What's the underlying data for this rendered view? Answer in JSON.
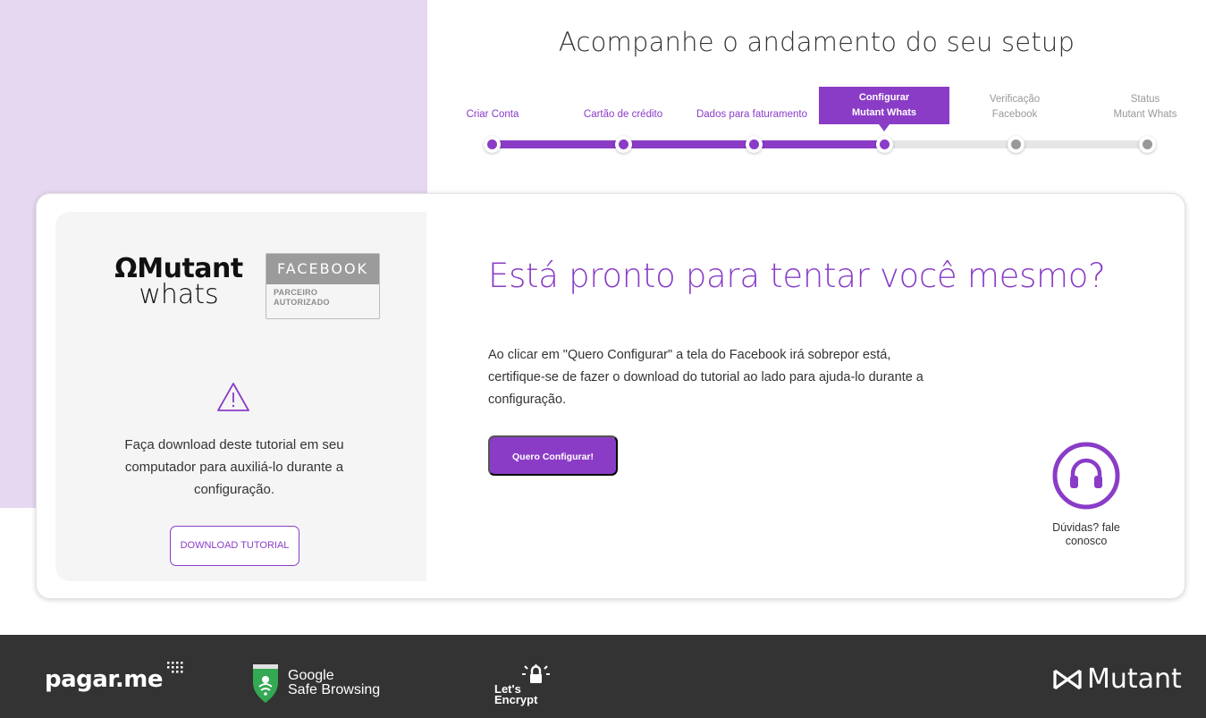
{
  "header": {
    "title": "Acompanhe o andamento do seu setup"
  },
  "steps": [
    {
      "line1": "",
      "line2": "Criar Conta",
      "state": "done"
    },
    {
      "line1": "",
      "line2": "Cartão de crédito",
      "state": "done"
    },
    {
      "line1": "",
      "line2": "Dados para faturamento",
      "state": "done"
    },
    {
      "line1": "Configurar",
      "line2": "Mutant Whats",
      "state": "active"
    },
    {
      "line1": "Verificação",
      "line2": "Facebook",
      "state": "pending"
    },
    {
      "line1": "Status",
      "line2": "Mutant Whats",
      "state": "pending"
    }
  ],
  "left_panel": {
    "logo_line1": "Mutant",
    "logo_line2": "whats",
    "badge_top": "FACEBOOK",
    "badge_bottom_1": "PARCEIRO",
    "badge_bottom_2": "AUTORIZADO",
    "warning_icon": "warning-triangle-icon",
    "download_text": "Faça download deste tutorial em seu computador para auxiliá-lo durante a configuração.",
    "download_button": "DOWNLOAD TUTORIAL"
  },
  "main": {
    "title": "Está pronto para tentar você mesmo?",
    "text": "Ao clicar em \"Quero Configurar\" a tela do Facebook irá sobrepor está, certifique-se de fazer o download do tutorial ao lado para ajuda-lo durante a configuração.",
    "config_button": "Quero Configurar!"
  },
  "help": {
    "icon": "headset-icon",
    "text": "Dúvidas? fale conosco"
  },
  "footer": {
    "pagarme": "pagar.me",
    "gsb_line1": "Google",
    "gsb_line2": "Safe Browsing",
    "le_line1": "Let's",
    "le_line2": "Encrypt",
    "mutant": "Mutant"
  },
  "colors": {
    "accent": "#8a3cc7",
    "lilac": "#e5d8f0",
    "footer": "#333333"
  }
}
